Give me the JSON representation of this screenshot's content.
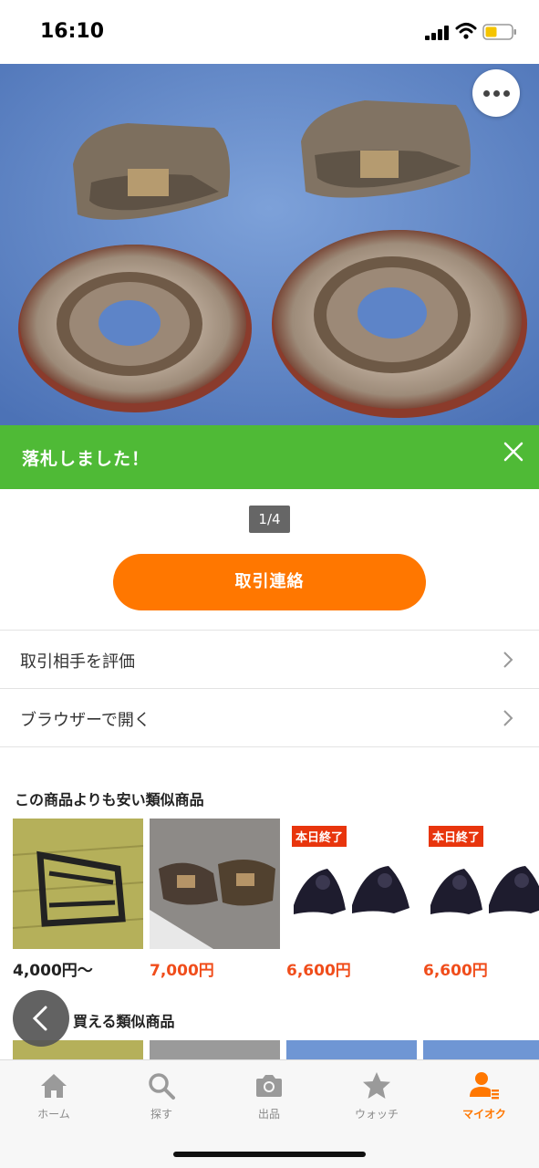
{
  "status_bar": {
    "time": "16:10",
    "icons": [
      "signal-icon",
      "wifi-icon",
      "battery-icon"
    ]
  },
  "photo": {
    "icon": "more-icon"
  },
  "banner": {
    "message": "落札しました！",
    "close_icon": "close-icon",
    "color": "#4fba36"
  },
  "page_indicator": "1/4",
  "primary_button": {
    "label": "取引連絡",
    "color": "#ff7700"
  },
  "menu": [
    {
      "label": "取引相手を評価",
      "icon": "chevron-right-icon"
    },
    {
      "label": "ブラウザーで開く",
      "icon": "chevron-right-icon"
    }
  ],
  "similar_cheaper": {
    "title": "この商品よりも安い類似商品",
    "items": [
      {
        "price": "4,000円〜",
        "badge": ""
      },
      {
        "price": "7,000円",
        "badge": ""
      },
      {
        "price": "6,600円",
        "badge": "本日終了"
      },
      {
        "price": "6,600円",
        "badge": "本日終了"
      }
    ]
  },
  "similar_buy_now": {
    "title": "買える類似商品"
  },
  "tab_bar": {
    "tabs": [
      {
        "label": "ホーム",
        "icon": "home-icon",
        "active": false
      },
      {
        "label": "探す",
        "icon": "search-icon",
        "active": false
      },
      {
        "label": "出品",
        "icon": "camera-icon",
        "active": false
      },
      {
        "label": "ウォッチ",
        "icon": "star-icon",
        "active": false
      },
      {
        "label": "マイオク",
        "icon": "my-account-icon",
        "active": true
      }
    ]
  },
  "colors": {
    "accent": "#ff7700",
    "success": "#4fba36",
    "price_red": "#f04d1b",
    "badge_red": "#e8350d"
  }
}
